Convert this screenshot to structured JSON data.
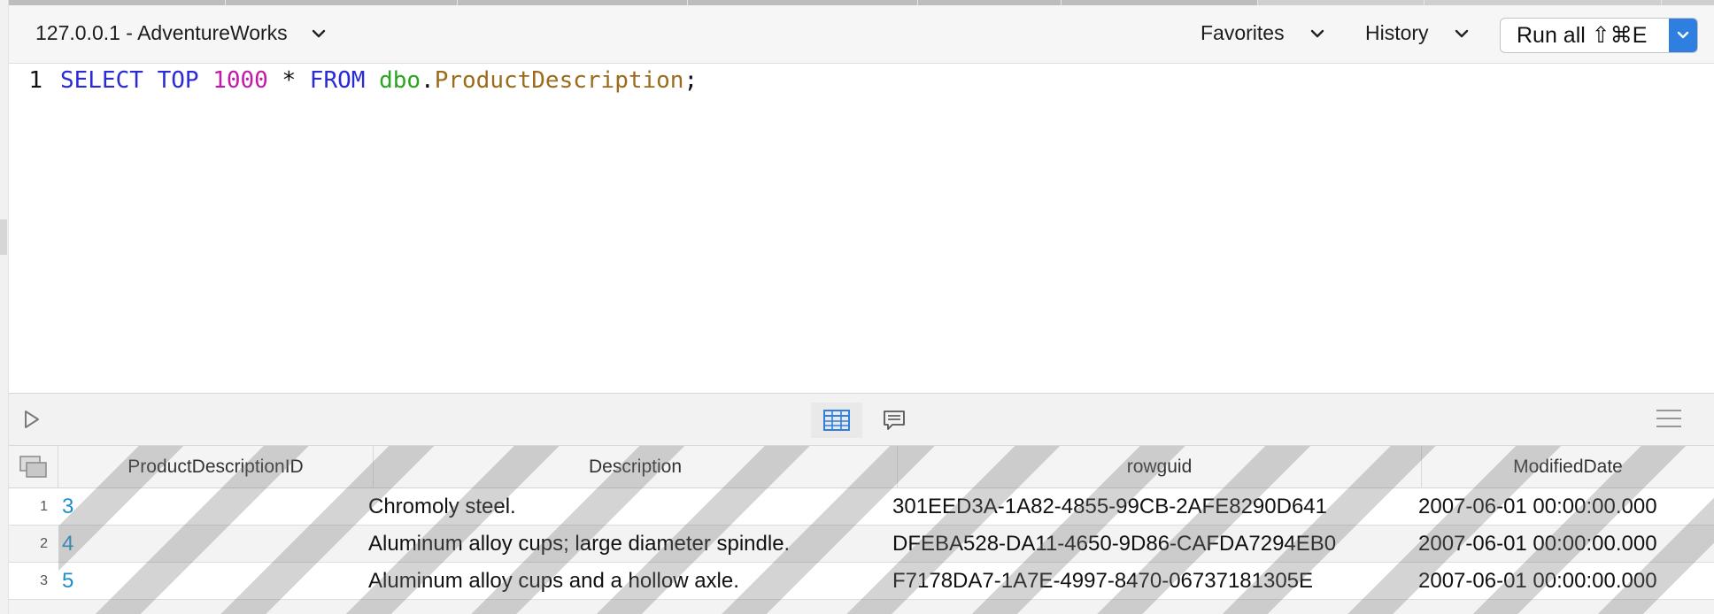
{
  "toolbar": {
    "connection": "127.0.0.1 - AdventureWorks",
    "favorites_label": "Favorites",
    "history_label": "History",
    "run_label": "Run all ⇧⌘E"
  },
  "editor": {
    "line_number": "1",
    "tokens": {
      "select": "SELECT",
      "top": "TOP",
      "limit": "1000",
      "star": "*",
      "from": "FROM",
      "schema": "dbo",
      "dot": ".",
      "table": "ProductDescription",
      "semicolon": ";"
    }
  },
  "results": {
    "columns": [
      "ProductDescriptionID",
      "Description",
      "rowguid",
      "ModifiedDate"
    ],
    "rows": [
      {
        "n": "1",
        "id": "3",
        "description": "Chromoly steel.",
        "rowguid": "301EED3A-1A82-4855-99CB-2AFE8290D641",
        "modified": "2007-06-01 00:00:00.000"
      },
      {
        "n": "2",
        "id": "4",
        "description": "Aluminum alloy cups; large diameter spindle.",
        "rowguid": "DFEBA528-DA11-4650-9D86-CAFDA7294EB0",
        "modified": "2007-06-01 00:00:00.000"
      },
      {
        "n": "3",
        "id": "5",
        "description": "Aluminum alloy cups and a hollow axle.",
        "rowguid": "F7178DA7-1A7E-4997-8470-06737181305E",
        "modified": "2007-06-01 00:00:00.000"
      }
    ]
  },
  "icons": {
    "play": "play-icon",
    "grid": "grid-view-icon",
    "messages": "messages-icon",
    "menu": "hamburger-menu-icon",
    "corner": "copy-rows-icon"
  },
  "colors": {
    "keyword": "#2a2ad6",
    "number": "#c21aa7",
    "schema": "#2aa51f",
    "object": "#9c6c1b",
    "accent": "#2f7fe0",
    "id_link": "#1c8fc9"
  }
}
